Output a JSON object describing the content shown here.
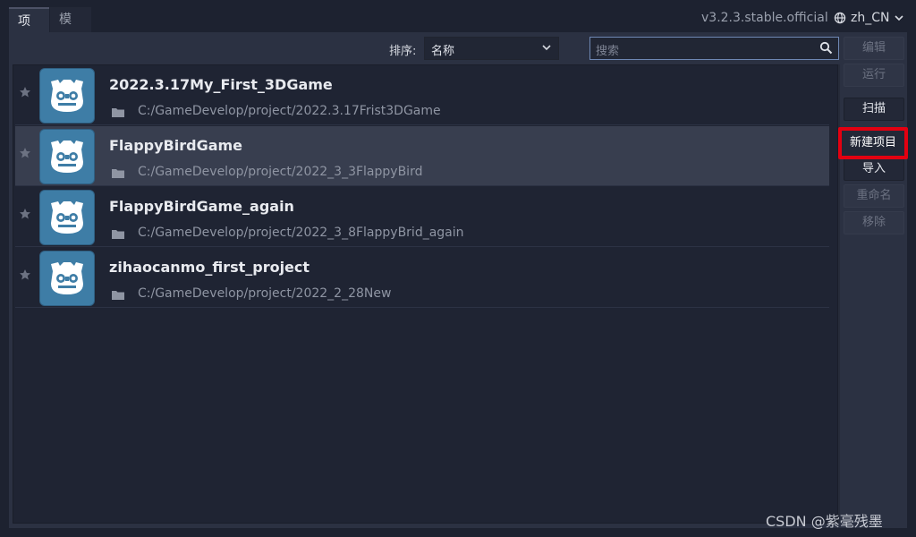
{
  "tabs": [
    {
      "label": "项目",
      "active": true
    },
    {
      "label": "模板",
      "active": false
    }
  ],
  "version": "v3.2.3.stable.official",
  "language": "zh_CN",
  "toolbar": {
    "sort_label": "排序:",
    "sort_value": "名称",
    "search_placeholder": "搜索"
  },
  "projects": [
    {
      "name": "2022.3.17My_First_3DGame",
      "path": "C:/GameDevelop/project/2022.3.17Frist3DGame",
      "selected": false
    },
    {
      "name": "FlappyBirdGame",
      "path": "C:/GameDevelop/project/2022_3_3FlappyBird",
      "selected": true
    },
    {
      "name": "FlappyBirdGame_again",
      "path": "C:/GameDevelop/project/2022_3_8FlappyBrid_again",
      "selected": false
    },
    {
      "name": "zihaocanmo_first_project",
      "path": "C:/GameDevelop/project/2022_2_28New",
      "selected": false
    }
  ],
  "actions": {
    "edit": "编辑",
    "run": "运行",
    "scan": "扫描",
    "new_project": "新建项目",
    "import": "导入",
    "rename": "重命名",
    "remove": "移除"
  },
  "highlight_color": "#e30011",
  "watermark": "CSDN @紫毫残墨"
}
